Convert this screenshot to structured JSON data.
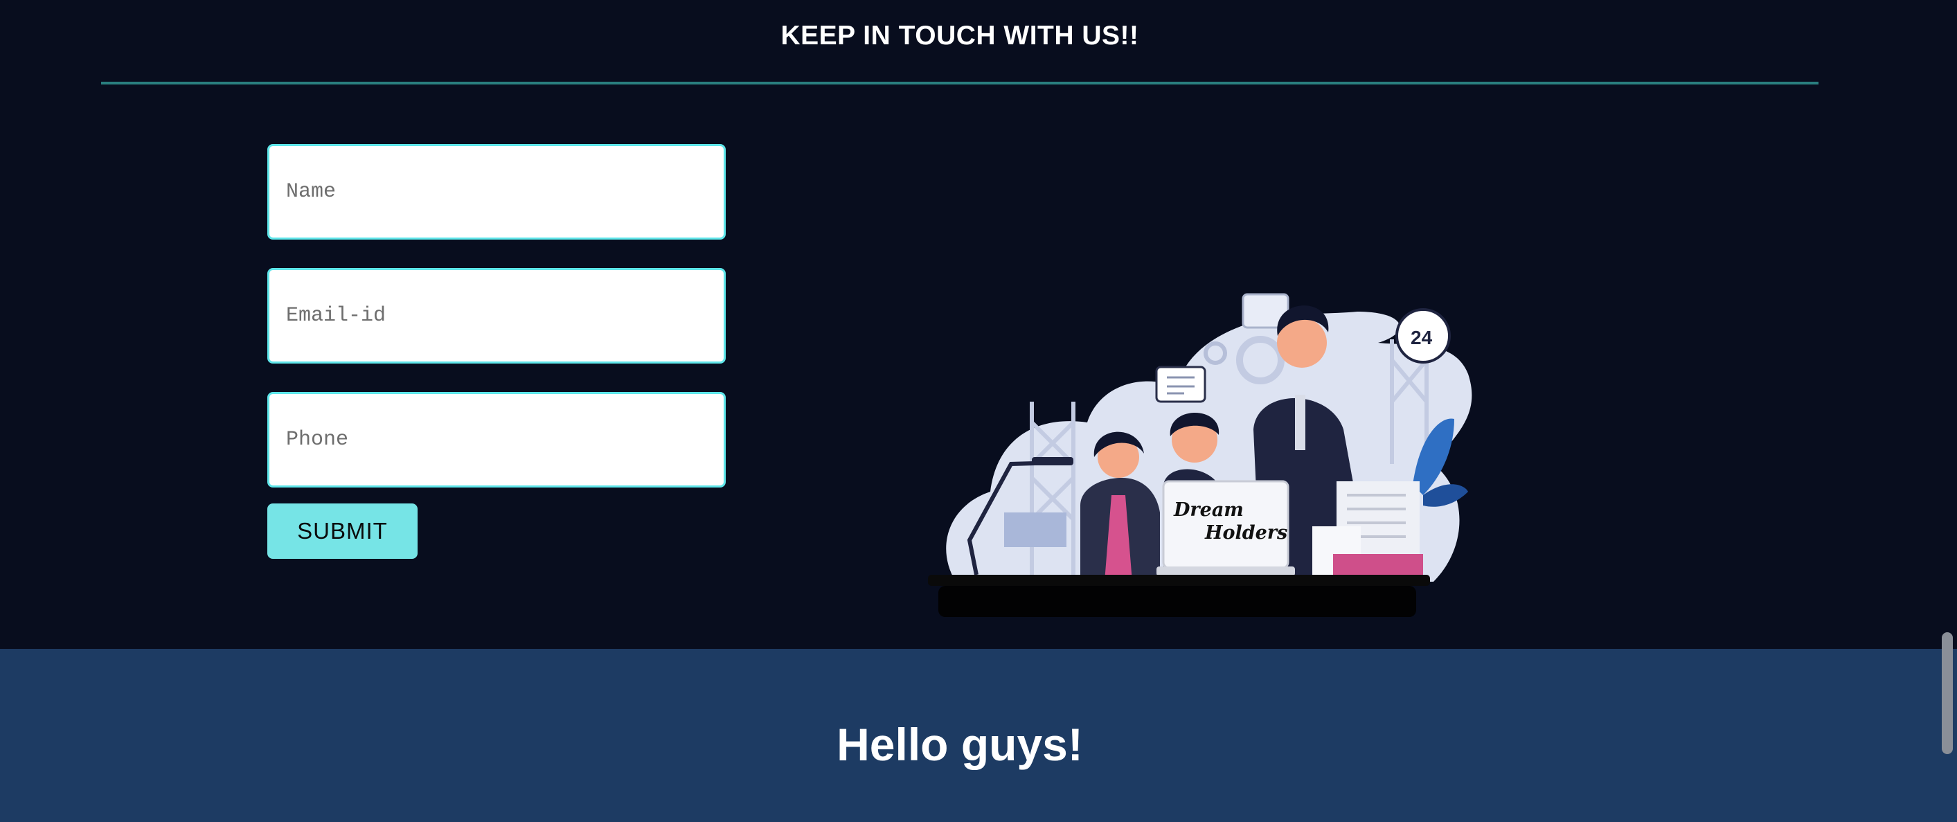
{
  "contact": {
    "heading": "KEEP IN TOUCH WITH US!!",
    "fields": {
      "name_placeholder": "Name",
      "email_placeholder": "Email-id",
      "phone_placeholder": "Phone"
    },
    "submit_label": "SUBMIT"
  },
  "illustration": {
    "laptop_text_line1": "Dream",
    "laptop_text_line2": "Holders",
    "badge_text": "24"
  },
  "hello": {
    "title": "Hello guys!"
  },
  "colors": {
    "page_background": "#080d1e",
    "divider": "#2a7f80",
    "input_border": "#5ee6ea",
    "button": "#76e4e6",
    "hello_section": "#1d3b63"
  }
}
